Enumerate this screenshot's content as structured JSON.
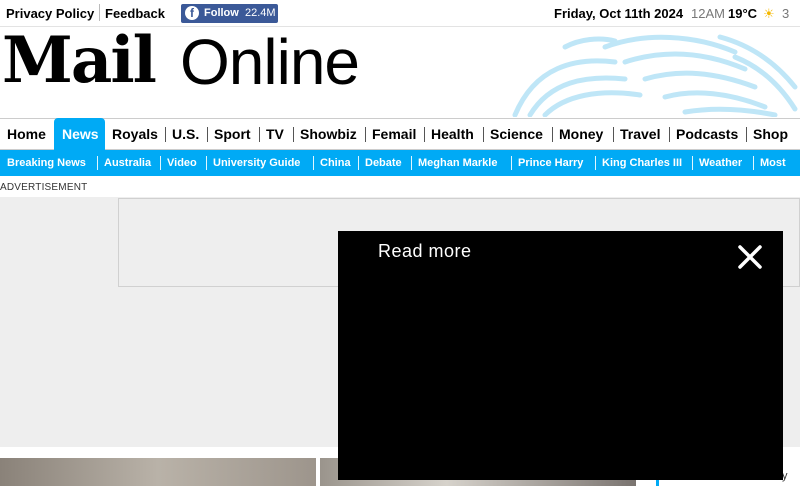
{
  "topbar": {
    "privacy_policy": "Privacy Policy",
    "feedback": "Feedback",
    "facebook_follow": "Follow",
    "facebook_count": "22.4M",
    "date": "Friday, Oct 11th 2024",
    "time": "12AM",
    "temperature": "19°C",
    "temperature_next": "3"
  },
  "masthead": {
    "logo_mail": "Mail",
    "logo_online": "Online"
  },
  "main_nav": {
    "active": "News",
    "items": [
      "Home",
      "News",
      "Royals",
      "U.S.",
      "Sport",
      "TV",
      "Showbiz",
      "Femail",
      "Health",
      "Science",
      "Money",
      "Travel",
      "Podcasts",
      "Shop"
    ]
  },
  "sub_nav": {
    "items": [
      "Breaking News",
      "Australia",
      "Video",
      "University Guide",
      "China",
      "Debate",
      "Meghan Markle",
      "Prince Harry",
      "King Charles III",
      "Weather",
      "Most"
    ]
  },
  "ad": {
    "label": "ADVERTISEMENT"
  },
  "video_player": {
    "read_more": "Read more"
  },
  "sidebar_peek": {
    "text": "y"
  },
  "colors": {
    "accent": "#00aaf5",
    "facebook": "#3b5998"
  }
}
